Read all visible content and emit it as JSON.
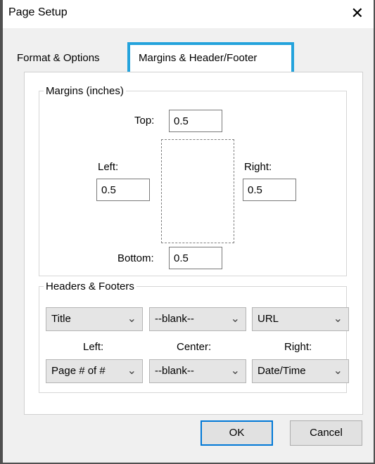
{
  "window": {
    "title": "Page Setup",
    "close_glyph": "✕"
  },
  "tabs": [
    {
      "label": "Format & Options"
    },
    {
      "label": "Margins & Header/Footer",
      "selected": true,
      "highlight_color": "#24a3dc"
    }
  ],
  "margins": {
    "legend": "Margins (inches)",
    "top": {
      "label": "Top:",
      "value": "0.5"
    },
    "left": {
      "label": "Left:",
      "value": "0.5"
    },
    "right": {
      "label": "Right:",
      "value": "0.5"
    },
    "bottom": {
      "label": "Bottom:",
      "value": "0.5"
    }
  },
  "headers_footers": {
    "legend": "Headers & Footers",
    "header_selects": [
      "Title",
      "--blank--",
      "URL"
    ],
    "column_labels": [
      "Left:",
      "Center:",
      "Right:"
    ],
    "footer_selects": [
      "Page # of #",
      "--blank--",
      "Date/Time"
    ]
  },
  "buttons": {
    "ok": "OK",
    "cancel": "Cancel"
  },
  "icons": {
    "dropdown": "chevron-down-icon"
  }
}
